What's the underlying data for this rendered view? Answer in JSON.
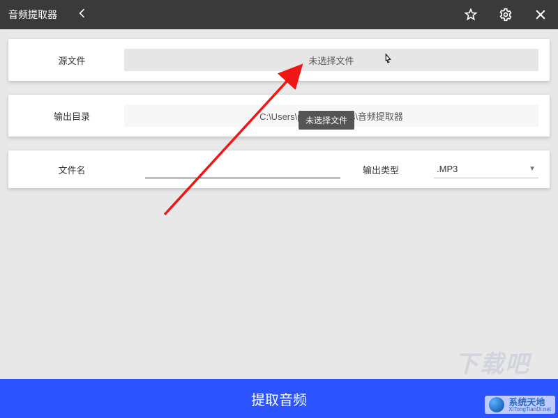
{
  "app": {
    "title": "音频提取器"
  },
  "source": {
    "label": "源文件",
    "button_text": "未选择文件",
    "tooltip": "未选择文件"
  },
  "output_dir": {
    "label": "输出目录",
    "path": "C:\\Users\\pc\\Documents\\音频提取器"
  },
  "filename": {
    "label": "文件名",
    "value": ""
  },
  "output_type": {
    "label": "输出类型",
    "selected": ".MP3"
  },
  "action": {
    "extract_label": "提取音频"
  },
  "watermark": {
    "cn": "系统天地",
    "en": "XiTongTianDi.net",
    "ghost": "下载吧"
  },
  "colors": {
    "titlebar": "#3a3a3a",
    "primary": "#2b53ff",
    "annotation": "#f11515"
  }
}
